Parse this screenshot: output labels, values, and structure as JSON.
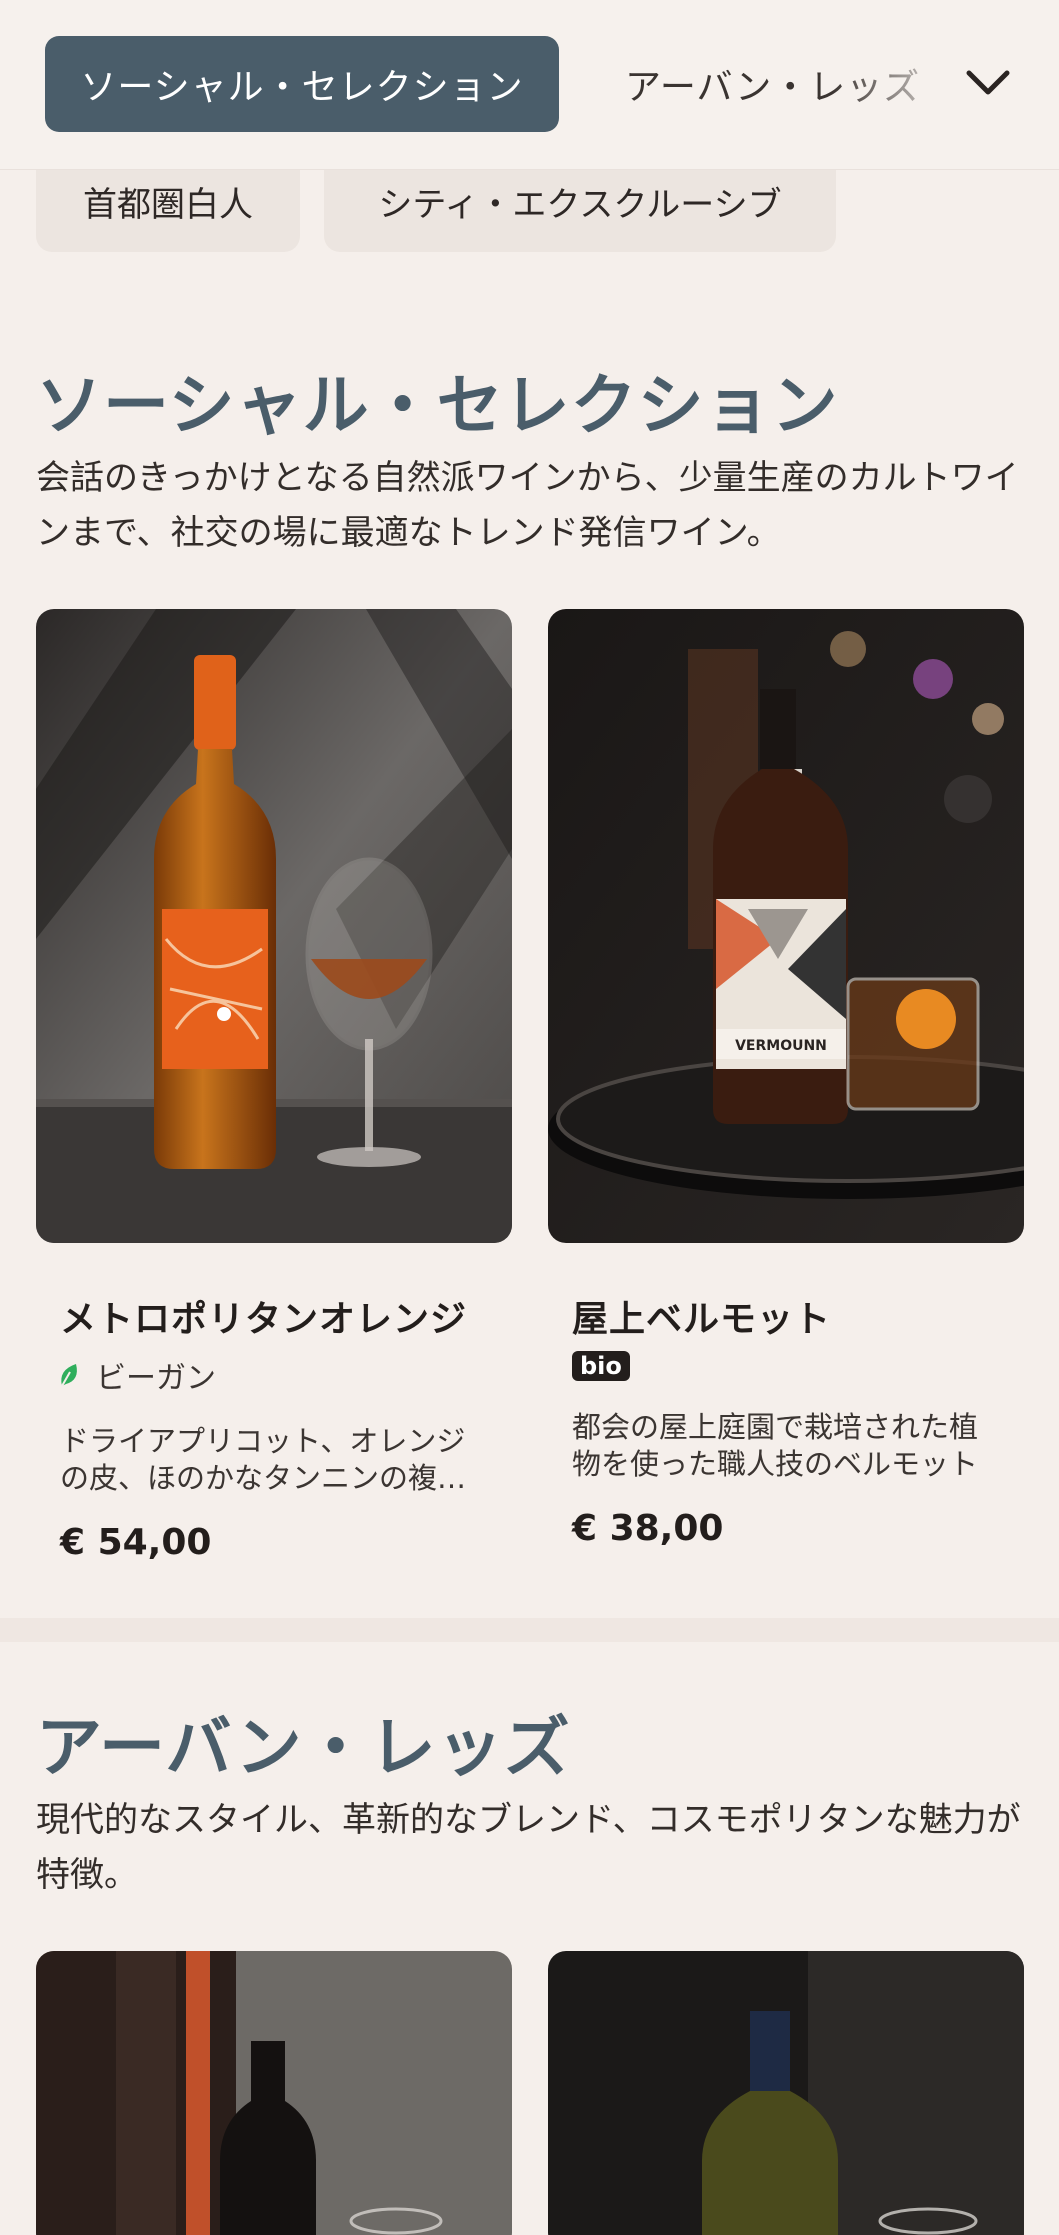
{
  "nav": {
    "active_tab": "ソーシャル・セレクション",
    "next_tab": "アーバン・レッズ",
    "expand_icon": "chevron-down-icon"
  },
  "chips": [
    "首都圏白人",
    "シティ・エクスクルーシブ"
  ],
  "sections": [
    {
      "title": "ソーシャル・セレクション",
      "description": "会話のきっかけとなる自然派ワインから、少量生産のカルトワインまで、社交の場に最適なトレンド発信ワイン。",
      "products": [
        {
          "name": "メトロポリタンオレンジ",
          "tag": "ビーガン",
          "tag_icon": "leaf-icon",
          "description": "ドライアプリコット、オレンジの皮、ほのかなタンニンの複雑な味わい",
          "price": "€ 54,00"
        },
        {
          "name": "屋上ベルモット",
          "tag": "bio",
          "description": "都会の屋上庭園で栽培された植物を使った職人技のベルモット",
          "price": "€ 38,00",
          "label_text": "VERMOUNN"
        }
      ]
    },
    {
      "title": "アーバン・レッズ",
      "description": "現代的なスタイル、革新的なブレンド、コスモポリタンな魅力が特徴。"
    }
  ],
  "colors": {
    "accent": "#4a5d6a",
    "background": "#f5efeb",
    "vegan_green": "#2fae5c"
  }
}
